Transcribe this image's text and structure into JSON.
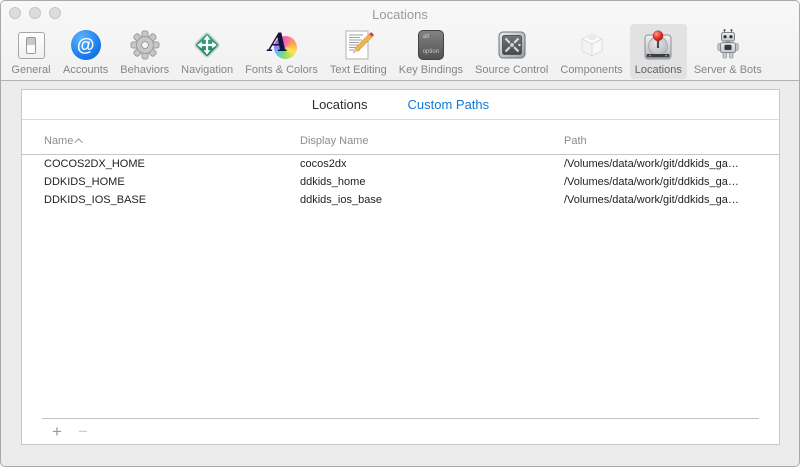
{
  "window": {
    "title": "Locations"
  },
  "toolbar": {
    "items": [
      {
        "label": "General",
        "icon": "general-icon"
      },
      {
        "label": "Accounts",
        "icon": "accounts-icon",
        "glyph": "@"
      },
      {
        "label": "Behaviors",
        "icon": "behaviors-icon"
      },
      {
        "label": "Navigation",
        "icon": "navigation-icon"
      },
      {
        "label": "Fonts & Colors",
        "icon": "fonts-colors-icon",
        "glyph": "A"
      },
      {
        "label": "Text Editing",
        "icon": "text-editing-icon"
      },
      {
        "label": "Key Bindings",
        "icon": "key-bindings-icon",
        "key_top": "alt",
        "key_bottom": "option"
      },
      {
        "label": "Source Control",
        "icon": "source-control-icon"
      },
      {
        "label": "Components",
        "icon": "components-icon"
      },
      {
        "label": "Locations",
        "icon": "locations-icon",
        "selected": true
      },
      {
        "label": "Server & Bots",
        "icon": "server-bots-icon"
      }
    ]
  },
  "tabs": [
    {
      "label": "Locations",
      "selected": false
    },
    {
      "label": "Custom Paths",
      "selected": true
    }
  ],
  "table": {
    "columns": [
      {
        "label": "Name",
        "sort": "ascending"
      },
      {
        "label": "Display Name"
      },
      {
        "label": "Path"
      }
    ],
    "rows": [
      {
        "name": "COCOS2DX_HOME",
        "display_name": "cocos2dx",
        "path": "/Volumes/data/work/git/ddkids_ga…"
      },
      {
        "name": "DDKIDS_HOME",
        "display_name": "ddkids_home",
        "path": "/Volumes/data/work/git/ddkids_ga…"
      },
      {
        "name": "DDKIDS_IOS_BASE",
        "display_name": "ddkids_ios_base",
        "path": "/Volumes/data/work/git/ddkids_ga…"
      }
    ]
  },
  "footer": {
    "add": "+",
    "remove": "−"
  },
  "colors": {
    "accent_blue": "#0d7ad8",
    "selected_item_bg": "#e2e2e2",
    "window_bg": "#ececec"
  }
}
